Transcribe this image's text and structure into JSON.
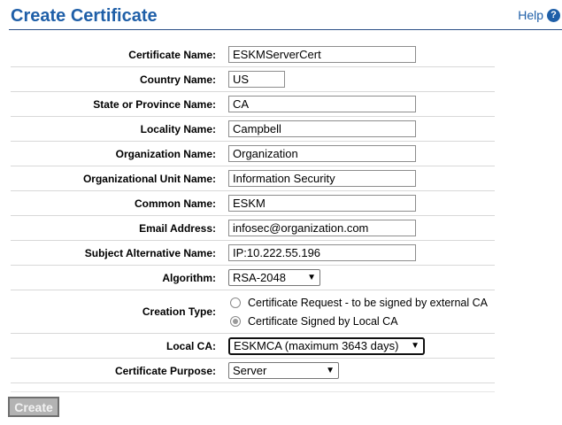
{
  "header": {
    "title": "Create Certificate",
    "help_label": "Help",
    "help_icon": "?"
  },
  "form": {
    "certificate_name": {
      "label": "Certificate Name:",
      "value": "ESKMServerCert"
    },
    "country_name": {
      "label": "Country Name:",
      "value": "US"
    },
    "state": {
      "label": "State or Province Name:",
      "value": "CA"
    },
    "locality": {
      "label": "Locality Name:",
      "value": "Campbell"
    },
    "organization": {
      "label": "Organization Name:",
      "value": "Organization"
    },
    "org_unit": {
      "label": "Organizational Unit Name:",
      "value": "Information Security"
    },
    "common_name": {
      "label": "Common Name:",
      "value": "ESKM"
    },
    "email": {
      "label": "Email Address:",
      "value": "infosec@organization.com"
    },
    "san": {
      "label": "Subject Alternative Name:",
      "value": "IP:10.222.55.196"
    },
    "algorithm": {
      "label": "Algorithm:",
      "value": "RSA-2048"
    },
    "creation_type": {
      "label": "Creation Type:",
      "options": [
        {
          "label": "Certificate Request - to be signed by external CA",
          "checked": false
        },
        {
          "label": "Certificate Signed by Local CA",
          "checked": true
        }
      ]
    },
    "local_ca": {
      "label": "Local CA:",
      "value": "ESKMCA (maximum 3643 days)"
    },
    "purpose": {
      "label": "Certificate Purpose:",
      "value": "Server"
    }
  },
  "actions": {
    "create_label": "Create"
  },
  "colors": {
    "accent": "#1f5fa8",
    "disabled_button": "#b3b3b3"
  }
}
